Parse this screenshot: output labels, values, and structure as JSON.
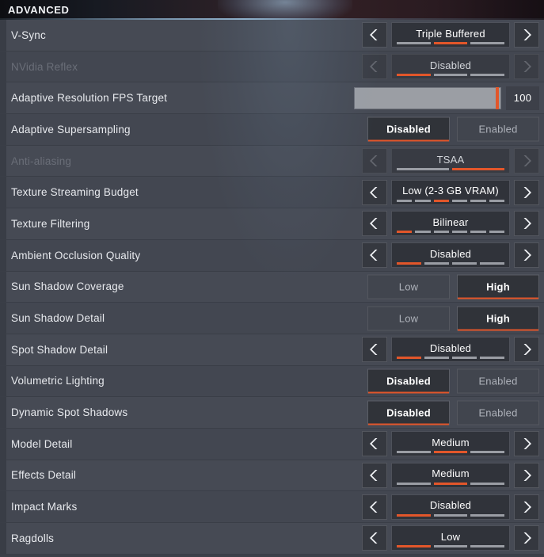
{
  "header": {
    "title": "ADVANCED"
  },
  "colors": {
    "accent": "#e2562a",
    "row_bg": "#464a54",
    "row_bg_alt": "#434751",
    "text": "#e8eaee",
    "text_disabled": "#6a6e78",
    "segment_off": "#9a9da4"
  },
  "rows": [
    {
      "label": "V-Sync",
      "type": "selector",
      "disabled": false,
      "value": "Triple Buffered",
      "segments": 3,
      "active_segment": 2,
      "prev_label": "‹",
      "next_label": "›"
    },
    {
      "label": "NVidia Reflex",
      "type": "selector",
      "disabled": true,
      "value": "Disabled",
      "segments": 3,
      "active_segment": 1,
      "prev_label": "‹",
      "next_label": "›"
    },
    {
      "label": "Adaptive Resolution FPS Target",
      "type": "slider",
      "disabled": false,
      "value": "100",
      "fill_percent": 98
    },
    {
      "label": "Adaptive Supersampling",
      "type": "toggle",
      "disabled": false,
      "options": [
        "Disabled",
        "Enabled"
      ],
      "selected_index": 0
    },
    {
      "label": "Anti-aliasing",
      "type": "selector",
      "disabled": true,
      "value": "TSAA",
      "segments": 2,
      "active_segment": 2,
      "prev_label": "‹",
      "next_label": "›"
    },
    {
      "label": "Texture Streaming Budget",
      "type": "selector",
      "disabled": false,
      "value": "Low (2-3 GB VRAM)",
      "segments": 6,
      "active_segment": 3,
      "prev_label": "‹",
      "next_label": "›"
    },
    {
      "label": "Texture Filtering",
      "type": "selector",
      "disabled": false,
      "value": "Bilinear",
      "segments": 6,
      "active_segment": 1,
      "prev_label": "‹",
      "next_label": "›"
    },
    {
      "label": "Ambient Occlusion Quality",
      "type": "selector",
      "disabled": false,
      "value": "Disabled",
      "segments": 4,
      "active_segment": 1,
      "prev_label": "‹",
      "next_label": "›"
    },
    {
      "label": "Sun Shadow Coverage",
      "type": "toggle",
      "disabled": false,
      "options": [
        "Low",
        "High"
      ],
      "selected_index": 1
    },
    {
      "label": "Sun Shadow Detail",
      "type": "toggle",
      "disabled": false,
      "options": [
        "Low",
        "High"
      ],
      "selected_index": 1
    },
    {
      "label": "Spot Shadow Detail",
      "type": "selector",
      "disabled": false,
      "value": "Disabled",
      "segments": 4,
      "active_segment": 1,
      "prev_label": "‹",
      "next_label": "›"
    },
    {
      "label": "Volumetric Lighting",
      "type": "toggle",
      "disabled": false,
      "options": [
        "Disabled",
        "Enabled"
      ],
      "selected_index": 0
    },
    {
      "label": "Dynamic Spot Shadows",
      "type": "toggle",
      "disabled": false,
      "options": [
        "Disabled",
        "Enabled"
      ],
      "selected_index": 0
    },
    {
      "label": "Model Detail",
      "type": "selector",
      "disabled": false,
      "value": "Medium",
      "segments": 3,
      "active_segment": 2,
      "prev_label": "‹",
      "next_label": "›"
    },
    {
      "label": "Effects Detail",
      "type": "selector",
      "disabled": false,
      "value": "Medium",
      "segments": 3,
      "active_segment": 2,
      "prev_label": "‹",
      "next_label": "›"
    },
    {
      "label": "Impact Marks",
      "type": "selector",
      "disabled": false,
      "value": "Disabled",
      "segments": 3,
      "active_segment": 1,
      "prev_label": "‹",
      "next_label": "›"
    },
    {
      "label": "Ragdolls",
      "type": "selector",
      "disabled": false,
      "value": "Low",
      "segments": 3,
      "active_segment": 1,
      "prev_label": "‹",
      "next_label": "›"
    }
  ]
}
